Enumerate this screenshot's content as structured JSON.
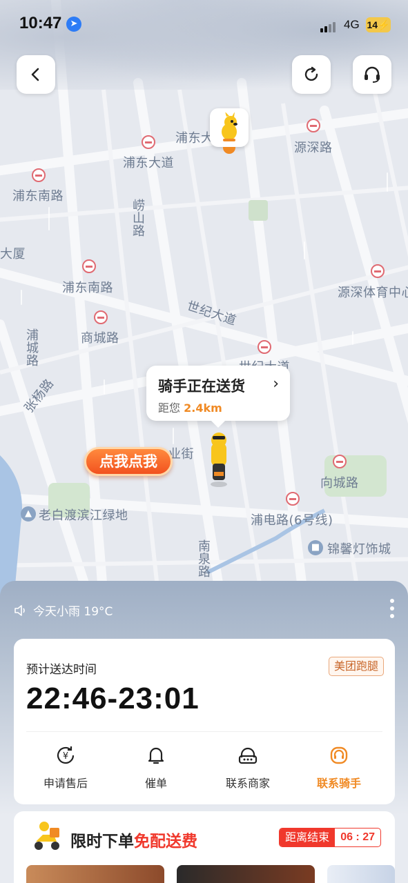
{
  "status_bar": {
    "time": "10:47",
    "network": "4G",
    "battery": "14"
  },
  "map": {
    "labels": [
      {
        "id": "pudong-dadao",
        "text": "浦东大道"
      },
      {
        "id": "pudong-top",
        "text": "浦东大"
      },
      {
        "id": "yuanshen-lu",
        "text": "源深路"
      },
      {
        "id": "pudong-nanlu-1",
        "text": "浦东南路"
      },
      {
        "id": "pudong-nanlu-2",
        "text": "浦东南路"
      },
      {
        "id": "laoshan-lu",
        "text": "崂山路"
      },
      {
        "id": "dasha",
        "text": "大厦"
      },
      {
        "id": "yuanshen-tiyu",
        "text": "源深体育中心"
      },
      {
        "id": "shiji-dadao",
        "text": "世纪大道"
      },
      {
        "id": "shiji-dadao-2",
        "text": "世纪大道"
      },
      {
        "id": "shangcheng-lu",
        "text": "商城路"
      },
      {
        "id": "pucheng-lu",
        "text": "浦城路"
      },
      {
        "id": "zhangyang-lu",
        "text": "张杨路"
      },
      {
        "id": "xiangcheng-lu",
        "text": "向城路"
      },
      {
        "id": "laobaidu",
        "text": "老白渡滨江绿地"
      },
      {
        "id": "pudian-lu",
        "text": "浦电路(6号线)"
      },
      {
        "id": "jinxin",
        "text": "锦馨灯饰城"
      },
      {
        "id": "nanquan-lu",
        "text": "南泉路"
      },
      {
        "id": "jie",
        "text": "业街"
      }
    ]
  },
  "bubble": {
    "title": "骑手正在送货",
    "distance_prefix": "距您",
    "distance": "2.4km"
  },
  "click_button": "点我点我",
  "weather": "今天小雨 19°C",
  "order": {
    "eta_label": "预计送达时间",
    "eta_time": "22:46-23:01",
    "brand": "美团跑腿",
    "actions": [
      {
        "label": "申请售后",
        "icon": "after-sale-icon"
      },
      {
        "label": "催单",
        "icon": "bell-icon"
      },
      {
        "label": "联系商家",
        "icon": "shop-service-icon"
      },
      {
        "label": "联系骑手",
        "icon": "rider-service-icon"
      }
    ]
  },
  "promo": {
    "title": "限时下单",
    "highlight": "免配送费",
    "end_label": "距离结束",
    "countdown": "06 : 27"
  },
  "colors": {
    "accent": "#f08a24",
    "promo_red": "#f0382c"
  }
}
